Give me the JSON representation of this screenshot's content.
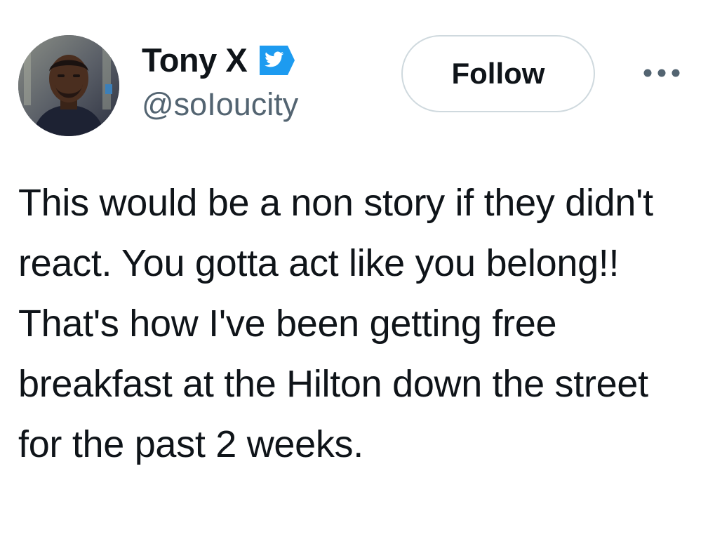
{
  "author": {
    "display_name": "Tony X",
    "handle": "@soIoucity",
    "verified": true,
    "verified_color": "#1d9bf0",
    "avatar_icon": "profile-photo"
  },
  "actions": {
    "follow_label": "Follow",
    "more_icon": "more-dots-icon"
  },
  "tweet": {
    "text": "This would be a non story if they didn't react. You gotta act like you belong!! That's how I've been getting free breakfast at the Hilton down the street for the past 2 weeks."
  },
  "colors": {
    "text_primary": "#0f1419",
    "text_secondary": "#536471",
    "border": "#cfd9de",
    "accent": "#1d9bf0"
  }
}
